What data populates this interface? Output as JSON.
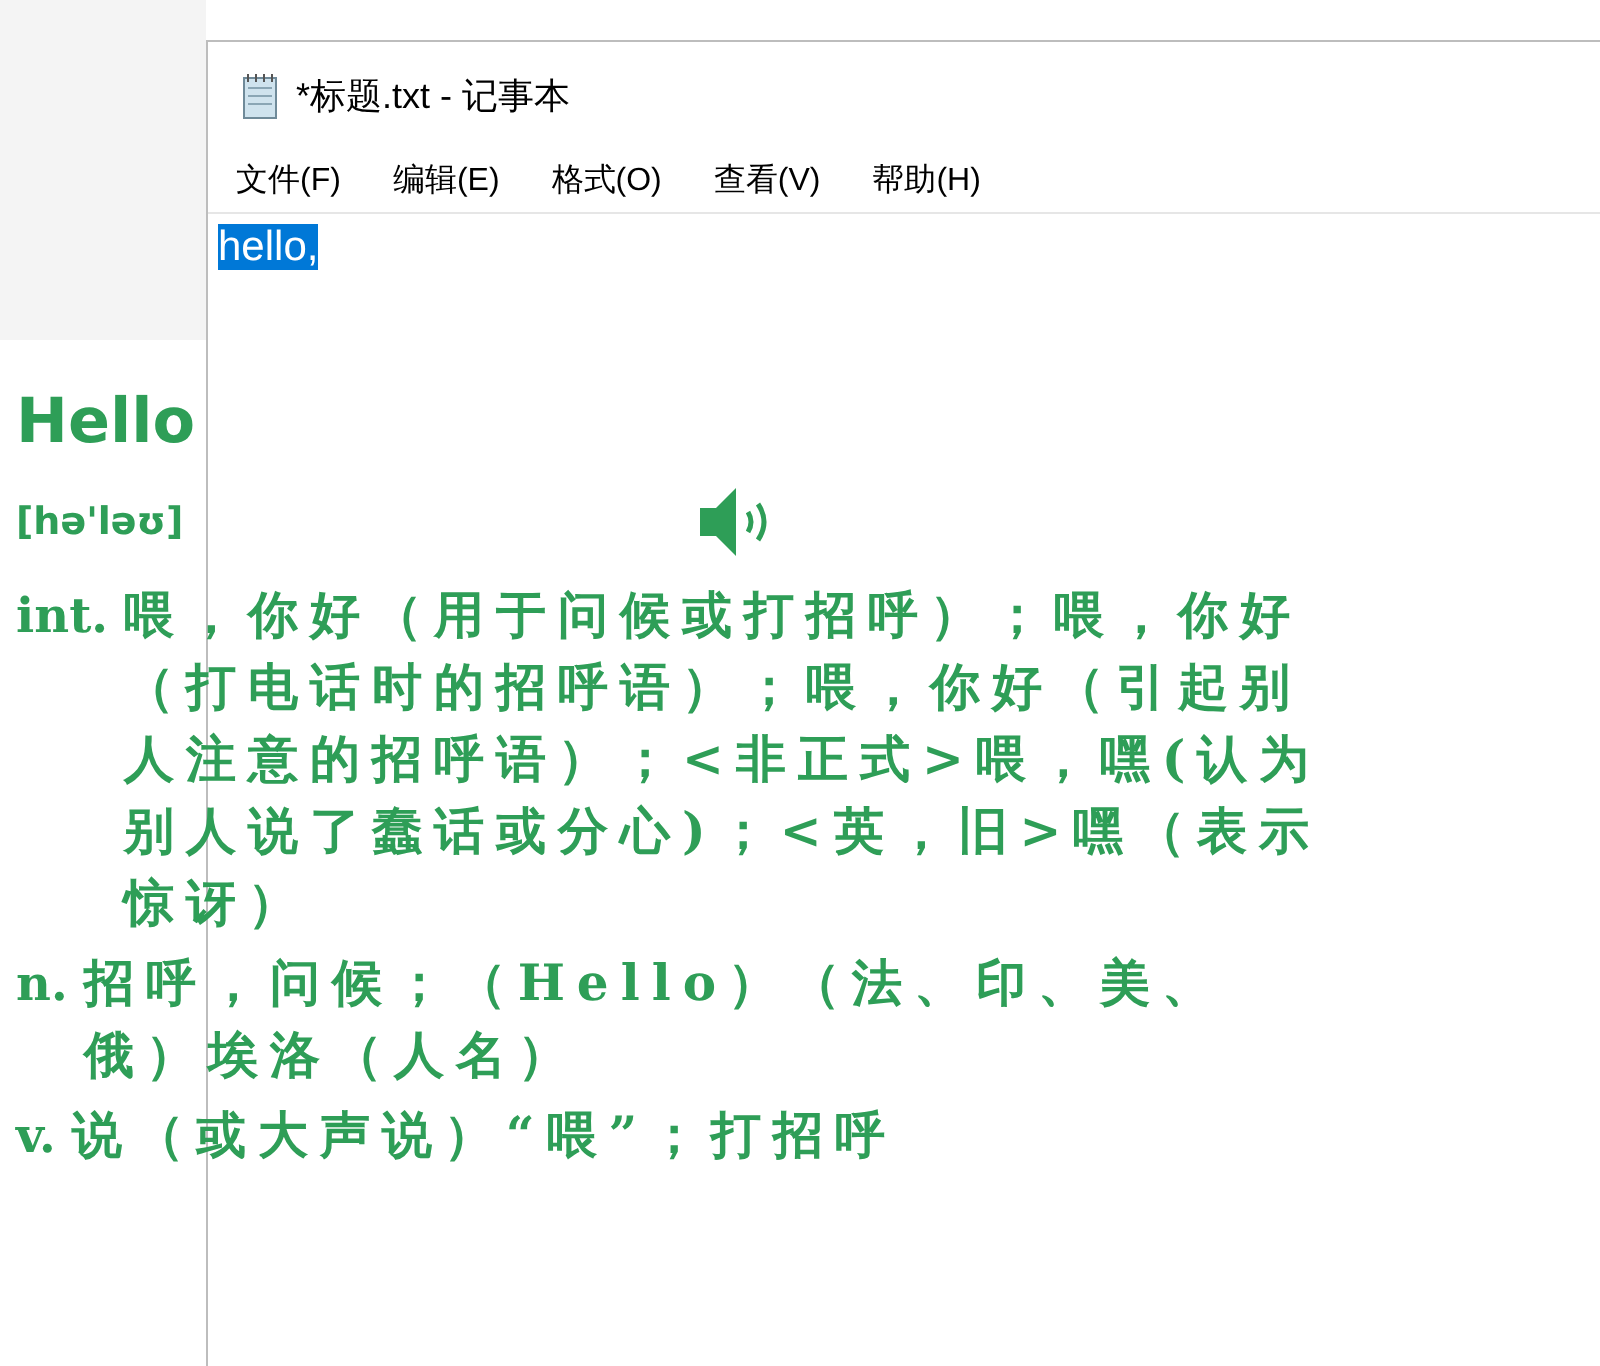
{
  "window": {
    "title": "*标题.txt - 记事本"
  },
  "menu": [
    "文件(F)",
    "编辑(E)",
    "格式(O)",
    "查看(V)",
    "帮助(H)"
  ],
  "editor": {
    "text": "hello,",
    "selected": true
  },
  "dictionary": {
    "word": "Hello",
    "phonetic": "[hə'ləʊ]",
    "senses": [
      {
        "pos": "int.",
        "definition": "喂，你好（用于问候或打招呼）；喂，你好（打电话时的招呼语）；喂，你好（引起别人注意的招呼语）；<非正式>喂，嘿(认为别人说了蠢话或分心)；<英，旧>嘿（表示惊讶）"
      },
      {
        "pos": "n.",
        "definition": "招呼，问候；（Hello）（法、印、美、俄）埃洛（人名）"
      },
      {
        "pos": "v.",
        "definition": "说（或大声说）“喂”；打招呼"
      }
    ]
  }
}
